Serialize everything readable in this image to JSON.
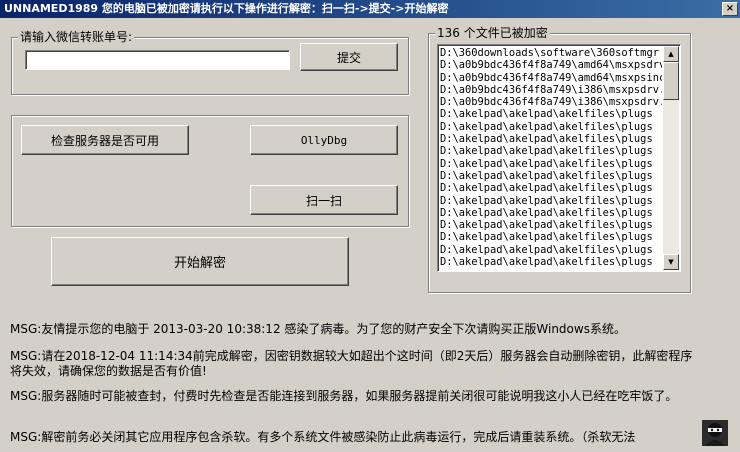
{
  "window": {
    "title": "UNNAMED1989 您的电脑已被加密请执行以下操作进行解密：扫一扫->提交->开始解密",
    "close_glyph": "×"
  },
  "order_group": {
    "label": "请输入微信转账单号:",
    "input_value": "",
    "submit_label": "提交"
  },
  "tools_group": {
    "check_server_label": "检查服务器是否可用",
    "ollydbg_label": "OllyDbg",
    "scan_label": "扫一扫"
  },
  "start_decrypt_label": "开始解密",
  "files_group": {
    "label": "136 个文件已被加密",
    "files": [
      "D:\\360downloads\\software\\360softmgr",
      "D:\\a0b9bdc436f4f8a749\\amd64\\msxpsdrv",
      "D:\\a0b9bdc436f4f8a749\\amd64\\msxpsinc",
      "D:\\a0b9bdc436f4f8a749\\i386\\msxpsdrv.",
      "D:\\a0b9bdc436f4f8a749\\i386\\msxpsdrv.",
      "D:\\akelpad\\akelpad\\akelfiles\\plugs",
      "D:\\akelpad\\akelpad\\akelfiles\\plugs",
      "D:\\akelpad\\akelpad\\akelfiles\\plugs",
      "D:\\akelpad\\akelpad\\akelfiles\\plugs",
      "D:\\akelpad\\akelpad\\akelfiles\\plugs",
      "D:\\akelpad\\akelpad\\akelfiles\\plugs",
      "D:\\akelpad\\akelpad\\akelfiles\\plugs",
      "D:\\akelpad\\akelpad\\akelfiles\\plugs",
      "D:\\akelpad\\akelpad\\akelfiles\\plugs",
      "D:\\akelpad\\akelpad\\akelfiles\\plugs",
      "D:\\akelpad\\akelpad\\akelfiles\\plugs",
      "D:\\akelpad\\akelpad\\akelfiles\\plugs",
      "D:\\akelpad\\akelpad\\akelfiles\\plugs"
    ]
  },
  "messages": [
    "MSG:友情提示您的电脑于 2013-03-20 10:38:12  感染了病毒。为了您的财产安全下次请购买正版Windows系统。",
    "MSG:请在2018-12-04 11:14:34前完成解密，因密钥数据较大如超出个这时间（即2天后）服务器会自动删除密钥，此解密程序将失效，请确保您的数据是否有价值!",
    "MSG:服务器随时可能被查封，付费时先检查是否能连接到服务器，如果服务器提前关闭很可能说明我这小人已经在吃牢饭了。",
    "MSG:解密前务必关闭其它应用程序包含杀软。有多个系统文件被感染防止此病毒运行，完成后请重装系统。（杀软无法"
  ]
}
